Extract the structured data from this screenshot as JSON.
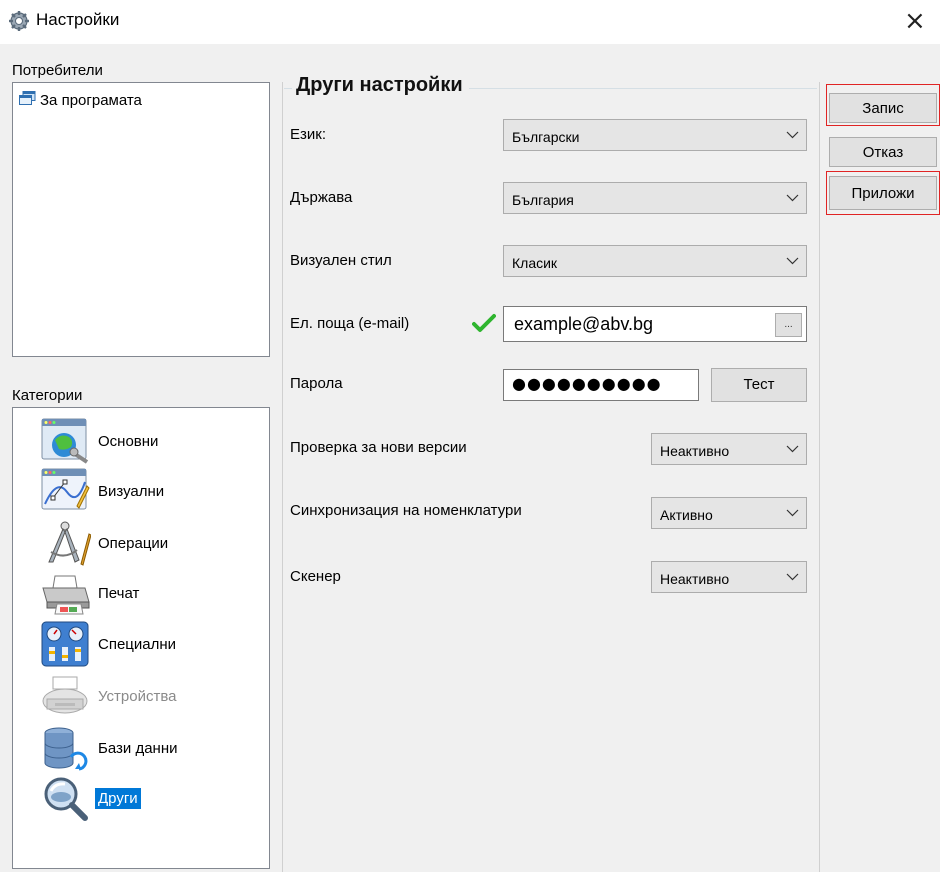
{
  "window": {
    "title": "Настройки",
    "close_label": "×"
  },
  "users_panel": {
    "label": "Потребители",
    "items": [
      "За програмата"
    ]
  },
  "categories_panel": {
    "label": "Категории",
    "items": [
      "Основни",
      "Визуални",
      "Операции",
      "Печат",
      "Специални",
      "Устройства",
      "Бази данни",
      "Други"
    ],
    "selected": "Други",
    "disabled": [
      "Устройства"
    ]
  },
  "settings": {
    "group_title": "Други настройки",
    "language": {
      "label": "Език:",
      "value": "Български"
    },
    "country": {
      "label": "Държава",
      "value": "България"
    },
    "visual_style": {
      "label": "Визуален стил",
      "value": "Класик"
    },
    "email": {
      "label": "Ел. поща (e-mail)",
      "value": "example@abv.bg",
      "browse_label": "...",
      "valid_icon": "check-icon"
    },
    "password": {
      "label": "Парола",
      "value": "●●●●●●●●●●",
      "test_label": "Тест"
    },
    "check_updates": {
      "label": "Проверка за нови версии",
      "value": "Неактивно"
    },
    "sync_nomenclatures": {
      "label": "Синхронизация на номенклатури",
      "value": "Активно"
    },
    "scanner": {
      "label": "Скенер",
      "value": "Неактивно"
    }
  },
  "actions": {
    "save_label": "Запис",
    "cancel_label": "Отказ",
    "apply_label": "Приложи"
  },
  "colors": {
    "selection": "#0078d7",
    "highlight_border": "#e02424",
    "check": "#2fb52f"
  }
}
